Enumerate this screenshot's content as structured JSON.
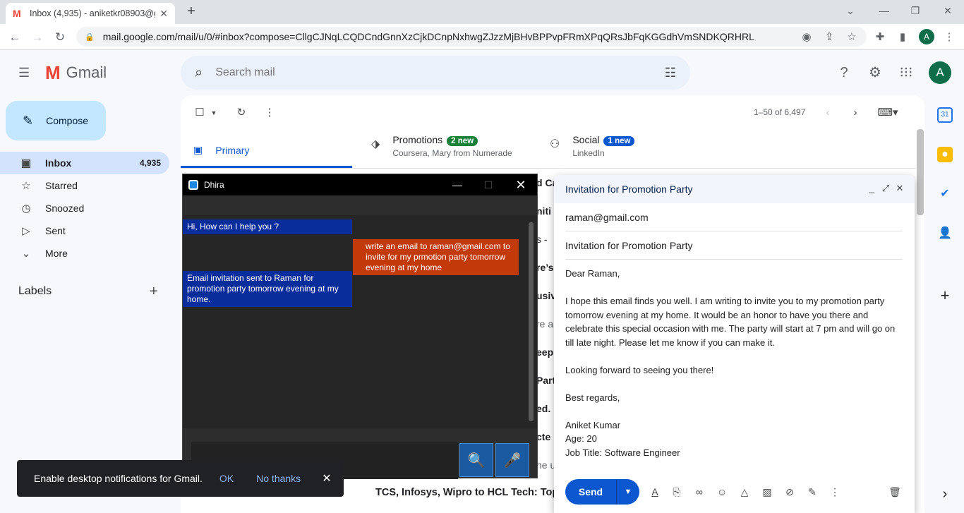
{
  "browser": {
    "tab_title": "Inbox (4,935) - aniketkr08903@g",
    "tab_favicon": "M",
    "new_tab": "+",
    "url": "mail.google.com/mail/u/0/#inbox?compose=CllgCJNqLCQDCndGnnXzCjkDCnpNxhwgZJzzMjBHvBPPvpFRmXPqQRsJbFqKGGdhVmSNDKQRHRL",
    "profile_initial": "A"
  },
  "gmail": {
    "logo_letter": "M",
    "logo_text": "Gmail",
    "search_placeholder": "Search mail",
    "avatar_initial": "A",
    "compose_label": "Compose",
    "nav": [
      {
        "label": "Inbox",
        "count": "4,935"
      },
      {
        "label": "Starred",
        "count": ""
      },
      {
        "label": "Snoozed",
        "count": ""
      },
      {
        "label": "Sent",
        "count": ""
      },
      {
        "label": "More",
        "count": ""
      }
    ],
    "labels_heading": "Labels",
    "pager": "1–50 of 6,497",
    "tabs": {
      "primary": "Primary",
      "promotions": "Promotions",
      "promotions_badge": "2 new",
      "promotions_sub": "Coursera, Mary from Numerade",
      "social": "Social",
      "social_badge": "1 new",
      "social_sub": "LinkedIn"
    },
    "row_fragments": [
      "d Ca",
      "niti",
      "s -",
      "re’s",
      "usiv",
      "re a",
      "eep",
      "Part",
      "ed. .",
      "cte",
      "he u"
    ],
    "last_row": "TCS, Infosys, Wipro to HCL Tech: Top"
  },
  "dhira": {
    "title": "Dhira",
    "messages": [
      {
        "from": "bot",
        "text": "Hi, How can I help you ?"
      },
      {
        "from": "user",
        "text": "write an email to raman@gmail.com to invite for my prmotion party tomorrow evening at my home"
      },
      {
        "from": "bot",
        "text": "Email invitation sent to Raman for promotion party tomorrow evening at my home."
      }
    ]
  },
  "snackbar": {
    "text": "Enable desktop notifications for Gmail.",
    "ok": "OK",
    "no_thanks": "No thanks"
  },
  "compose": {
    "title": "Invitation for Promotion Party",
    "to": "raman@gmail.com",
    "subject": "Invitation for Promotion Party",
    "greeting": "Dear Raman,",
    "body1": "I hope this email finds you well. I am writing to invite you to my promotion party tomorrow evening at my home. It would be an honor to have you there and celebrate this special occasion with me. The party will start at 7 pm and will go on till late night. Please let me know if you can make it.",
    "body2": "Looking forward to seeing you there!",
    "closing": "Best regards,",
    "sig_name": "Aniket Kumar",
    "sig_age": "Age: 20",
    "sig_title": "Job Title: Software Engineer",
    "send_label": "Send"
  }
}
